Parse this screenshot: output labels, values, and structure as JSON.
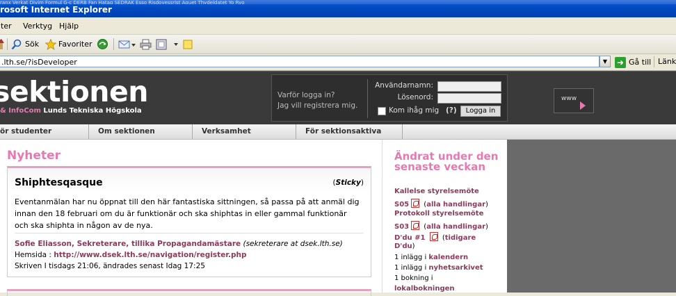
{
  "window": {
    "title": "rosoft Internet Explorer",
    "title_strip": "ranx  Verkat  Divim   Formul   G-c   DERB   Fan Hataq   SEDRAK   Esso   Risdovessrist   Aquet   Thydeldatet   Yo   Ryo"
  },
  "menu": {
    "items": [
      "iter",
      "Verktyg",
      "Hjälp"
    ]
  },
  "toolbar": {
    "search_label": "Sök",
    "favorites_label": "Favoriter"
  },
  "address": {
    "value": ".lth.se/?isDeveloper",
    "go_label": "Gå till",
    "links_label": "Länka"
  },
  "site": {
    "logo": "sektionen",
    "tagline_pink": "& InfoCom",
    "tagline_white": " Lunds Tekniska Högskola",
    "login": {
      "why": "Varför logga in?",
      "register": "Jag vill registrera mig.",
      "username_label": "Användarnamn:",
      "password_label": "Lösenord:",
      "remember_label": "Kom ihåg mig",
      "help": "(?)",
      "button": "Logga in"
    },
    "www_label": "www"
  },
  "nav": {
    "tabs": [
      "ör studenter",
      "Om sektionen",
      "Verksamhet",
      "För sektionsaktiva"
    ]
  },
  "news": {
    "heading": "Nyheter",
    "title": "Shiphtesqasque",
    "sticky_open": "(",
    "sticky": "Sticky",
    "sticky_close": ")",
    "body": "Eventanmälan har nu öppnat till den här fantastiska sittningen, så passa på att anmäl dig innan den 18 februari om du är funktionär och ska shiphtas in eller gammal funktionär och ska shiphta in någon av de nya.",
    "author": "Sofie Eliasson, Sekreterare, tillika Propagandamästare",
    "author_email": "(sekreterare at dsek.lth.se)",
    "homepage_label": "Hemsida : ",
    "homepage_url": "http://www.dsek.lth.se/navigation/register.php",
    "meta": "Skriven I tisdags 21:06, ändrades senast Idag 17:25"
  },
  "changes": {
    "heading": "Ändrat under den senaste veckan",
    "kallelse": "Kallelse styrelsemöte",
    "s05": "S05",
    "open1": " (",
    "alla_handlingar": "alla handlingar",
    "close1": ")",
    "protokoll": "Protokoll styrelsemöte",
    "s03": "S03",
    "ddu1": "D'du #1",
    "tidigare_open": " (",
    "tidigare": "tidigare",
    "ddu": "D'du",
    "tidigare_close": ")",
    "inlagg1_pre": "1 inlägg i ",
    "kalendern": "kalendern",
    "inlagg2_pre": "1 inlägg i ",
    "nyhetsarkivet": "nyhetsarkivet",
    "bokning_pre": "1 bokning i",
    "lokalbokningen": "lokalbokningen"
  }
}
